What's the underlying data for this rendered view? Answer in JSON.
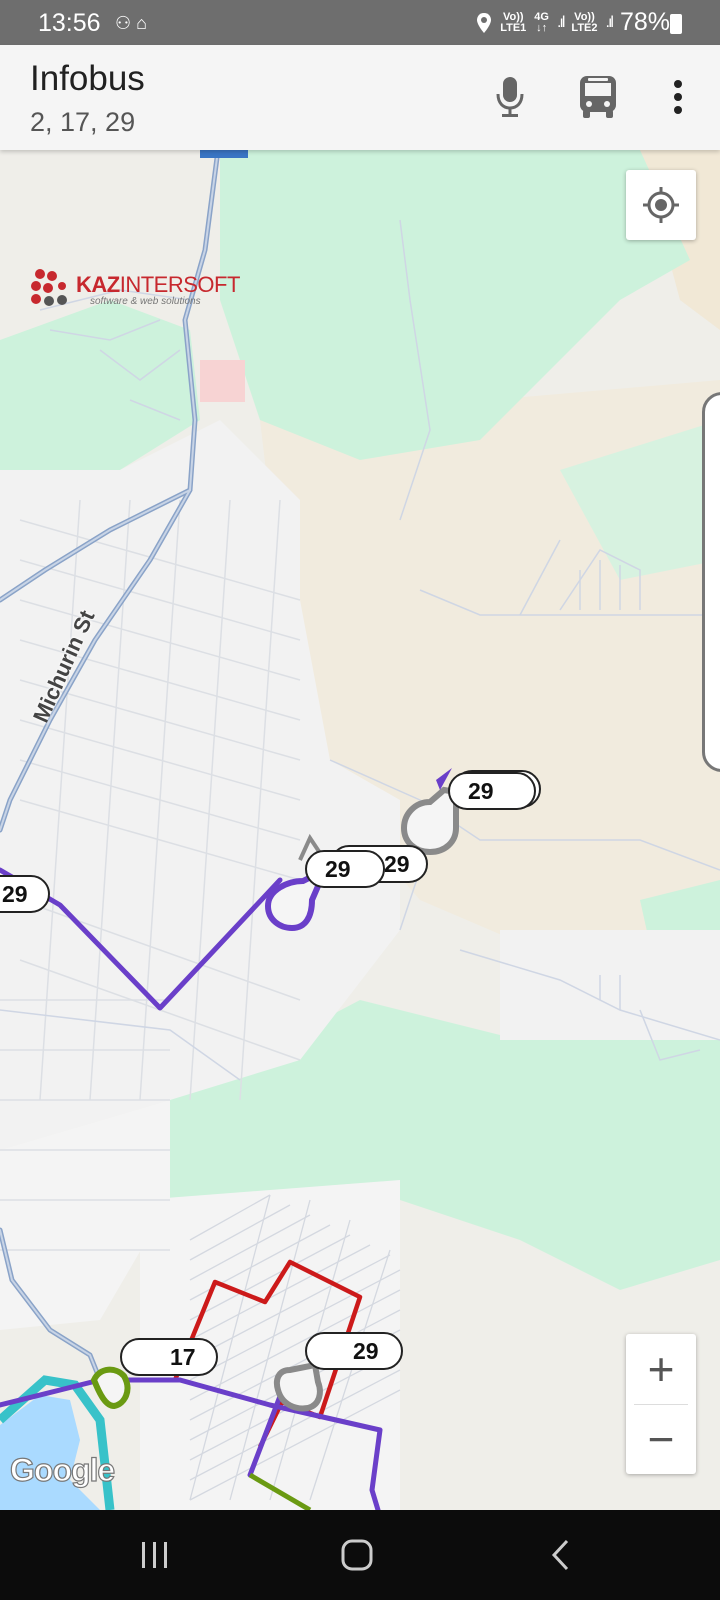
{
  "status_bar": {
    "time": "13:56",
    "left_icons": "⚇ ⌂",
    "sim1_top": "Vo))",
    "sim1_bottom": "LTE1",
    "net_top": "4G",
    "net_bottom": "↓↑",
    "sim2_top": "Vo))",
    "sim2_bottom": "LTE2",
    "battery": "78%"
  },
  "app_bar": {
    "title": "Infobus",
    "subtitle": "2, 17, 29",
    "icons": [
      "microphone-icon",
      "bus-icon",
      "more-vert-icon"
    ]
  },
  "map": {
    "logo": {
      "brand_bold": "KAZ",
      "brand_rest": "INTERSOFT",
      "tagline": "software & web solutions"
    },
    "street_label": "Michurin St",
    "bus_labels": [
      "29",
      "29",
      "29",
      "29",
      "17",
      "29"
    ],
    "attribution": "Google",
    "zoom_in": "+",
    "zoom_out": "−",
    "colors": {
      "route_29": "#6a3fc9",
      "route_17": "#6a9a12",
      "route_2": "#cc1a1a",
      "inactive_marker": "#8a8a8a",
      "highway": "#8aa3c8",
      "park": "#cdf2dc"
    }
  },
  "nav_bar": {
    "buttons": [
      "recent-apps-icon",
      "home-icon",
      "back-icon"
    ]
  }
}
